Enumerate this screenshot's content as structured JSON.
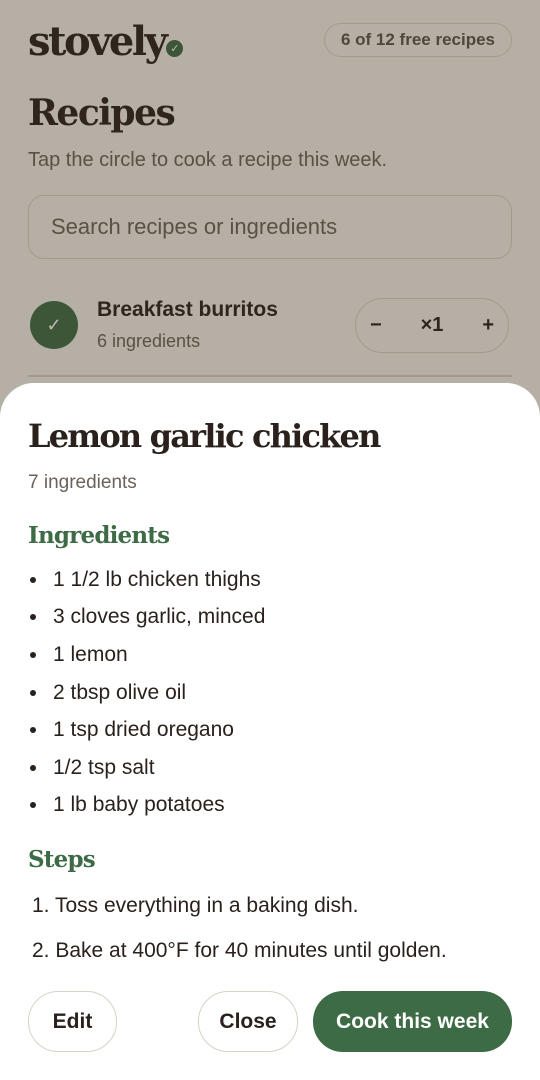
{
  "app": {
    "logo_text": "stovely",
    "quota": "6 of 12 free recipes"
  },
  "page": {
    "title": "Recipes",
    "subtitle": "Tap the circle to cook a recipe this week.",
    "search_placeholder": "Search recipes or ingredients"
  },
  "recipe_list": [
    {
      "name": "Breakfast burritos",
      "count": "6 ingredients",
      "selected": true,
      "multiplier": "×1",
      "minus": "−",
      "plus": "+"
    }
  ],
  "sheet": {
    "title": "Lemon garlic chicken",
    "subtitle": "7 ingredients",
    "ingredients_heading": "Ingredients",
    "ingredients": [
      "1 1/2 lb chicken thighs",
      "3 cloves garlic, minced",
      "1 lemon",
      "2 tbsp olive oil",
      "1 tsp dried oregano",
      "1/2 tsp salt",
      "1 lb baby potatoes"
    ],
    "steps_heading": "Steps",
    "steps": [
      "1. Toss everything in a baking dish.",
      "2. Bake at 400°F for 40 minutes until golden."
    ],
    "buttons": {
      "edit": "Edit",
      "close": "Close",
      "cook": "Cook this week"
    }
  },
  "icons": {
    "logo_badge": "check-icon",
    "row_check": "check-icon"
  },
  "colors": {
    "accent": "#3d6b45",
    "background": "#f5f2ec",
    "sheet": "#ffffff",
    "text": "#2a211c"
  }
}
